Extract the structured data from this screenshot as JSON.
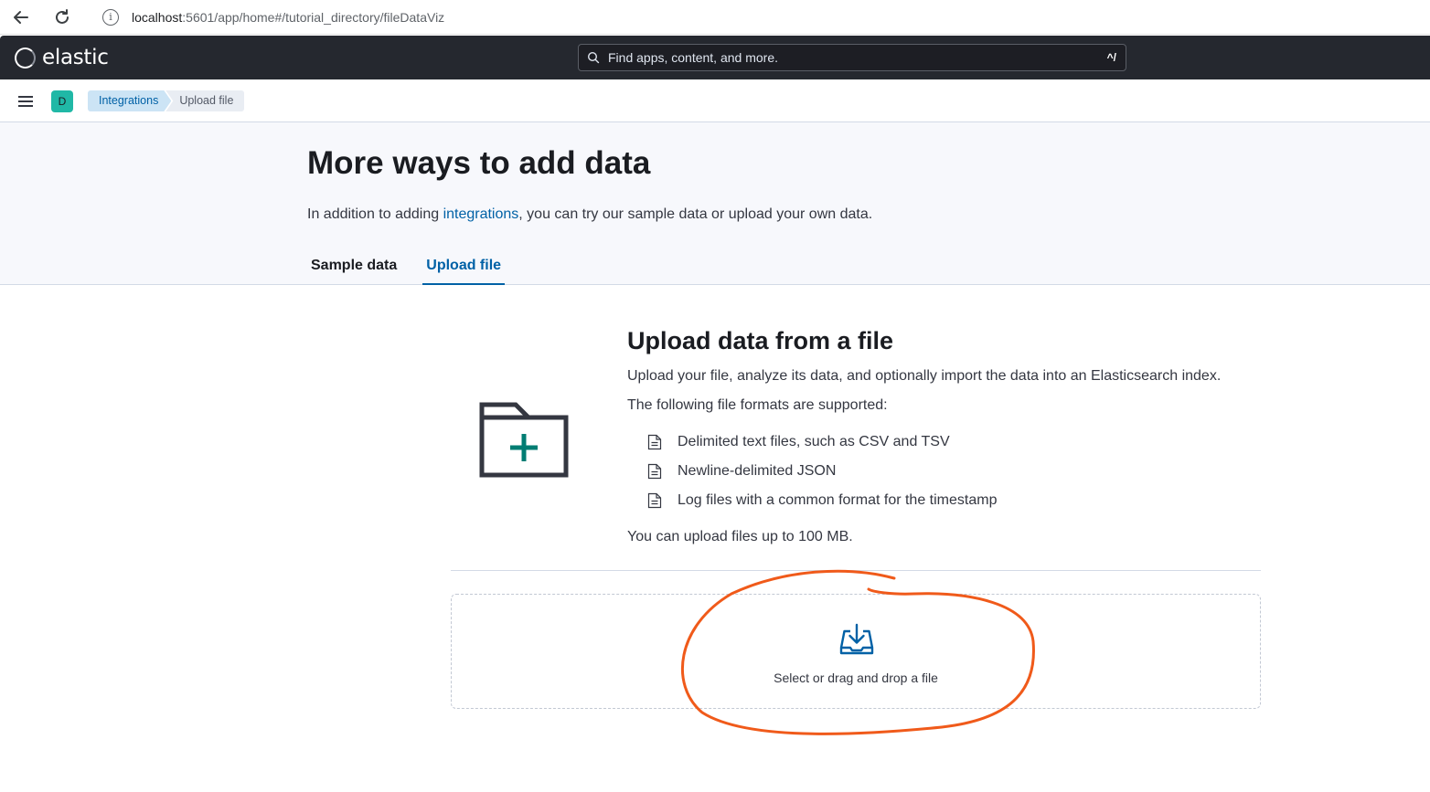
{
  "browser": {
    "url_host": "localhost",
    "url_rest": ":5601/app/home#/tutorial_directory/fileDataViz",
    "info_glyph": "i"
  },
  "header": {
    "logo_text": "elastic",
    "search_placeholder": "Find apps, content, and more.",
    "search_shortcut": "^/"
  },
  "crumbbar": {
    "space_initial": "D",
    "breadcrumbs": [
      "Integrations",
      "Upload file"
    ]
  },
  "page": {
    "title": "More ways to add data",
    "desc_before": "In addition to adding ",
    "desc_link": "integrations",
    "desc_after": ", you can try our sample data or upload your own data.",
    "tabs": [
      {
        "label": "Sample data",
        "active": false
      },
      {
        "label": "Upload file",
        "active": true
      }
    ]
  },
  "upload": {
    "title": "Upload data from a file",
    "description": "Upload your file, analyze its data, and optionally import the data into an Elasticsearch index.",
    "formats_intro": "The following file formats are supported:",
    "formats": [
      "Delimited text files, such as CSV and TSV",
      "Newline-delimited JSON",
      "Log files with a common format for the timestamp"
    ],
    "size_note": "You can upload files up to 100 MB.",
    "dropzone_label": "Select or drag and drop a file"
  },
  "colors": {
    "header_bg": "#25282f",
    "accent": "#0061a6",
    "folder_plus": "#017d73",
    "annotation": "#f05a1a"
  }
}
